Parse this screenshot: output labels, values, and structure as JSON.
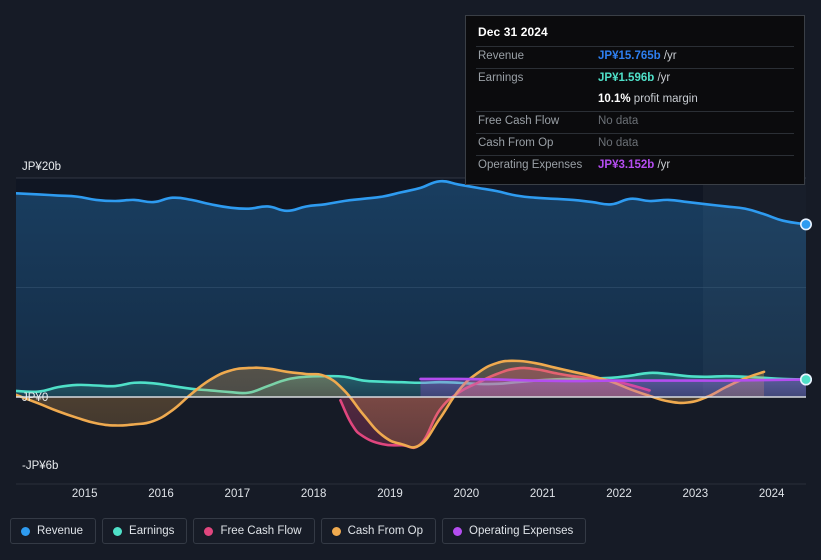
{
  "tooltip": {
    "title": "Dec 31 2024",
    "rows": [
      {
        "label": "Revenue",
        "value": "JP¥15.765b",
        "unit": "/yr",
        "style": "v-rev"
      },
      {
        "label": "Earnings",
        "value": "JP¥1.596b",
        "unit": "/yr",
        "style": "v-earn"
      },
      {
        "label": "",
        "value": "10.1%",
        "unit": "profit margin",
        "style": "v-margin"
      },
      {
        "label": "Free Cash Flow",
        "value": "No data",
        "unit": "",
        "style": "v-none"
      },
      {
        "label": "Cash From Op",
        "value": "No data",
        "unit": "",
        "style": "v-none"
      },
      {
        "label": "Operating Expenses",
        "value": "JP¥3.152b",
        "unit": "/yr",
        "style": "v-opex"
      }
    ]
  },
  "legend": {
    "items": [
      {
        "label": "Revenue",
        "color": "#2e9bf0"
      },
      {
        "label": "Earnings",
        "color": "#4fe0c8"
      },
      {
        "label": "Free Cash Flow",
        "color": "#e0467e"
      },
      {
        "label": "Cash From Op",
        "color": "#efaa4f"
      },
      {
        "label": "Operating Expenses",
        "color": "#b44df0"
      }
    ]
  },
  "axes": {
    "y_top_label": "JP¥20b",
    "y_zero_label": "JP¥0",
    "y_bottom_label": "-JP¥6b"
  },
  "chart_data": {
    "type": "area",
    "title": "",
    "xlabel": "",
    "ylabel": "",
    "currency": "JP¥",
    "unit": "b",
    "ylim": [
      -6,
      20
    ],
    "yticks": [
      20,
      0,
      -6
    ],
    "ytick_labels": [
      "JP¥20b",
      "JP¥0",
      "-JP¥6b"
    ],
    "grid": true,
    "legend_position": "bottom-left",
    "categories": [
      2015,
      2016,
      2017,
      2018,
      2019,
      2020,
      2021,
      2022,
      2023,
      2024
    ],
    "xtick_labels": [
      "2015",
      "2016",
      "2017",
      "2018",
      "2019",
      "2020",
      "2021",
      "2022",
      "2023",
      "2024"
    ],
    "x_domain": [
      2014.6,
      2024.95
    ],
    "forecast_band_start": 2023.6,
    "series": [
      {
        "name": "Revenue",
        "color": "#2e9bf0",
        "fill": "#1d4a6e",
        "x": [
          2014.6,
          2014.9,
          2015.15,
          2015.4,
          2015.65,
          2015.9,
          2016.15,
          2016.4,
          2016.65,
          2016.9,
          2017.15,
          2017.4,
          2017.65,
          2017.9,
          2018.15,
          2018.4,
          2018.65,
          2018.9,
          2019.15,
          2019.4,
          2019.65,
          2019.9,
          2020.15,
          2020.4,
          2020.65,
          2020.9,
          2021.15,
          2021.4,
          2021.65,
          2021.9,
          2022.15,
          2022.4,
          2022.65,
          2022.9,
          2023.15,
          2023.4,
          2023.65,
          2023.9,
          2024.15,
          2024.4,
          2024.65,
          2024.95
        ],
        "values": [
          18.6,
          18.5,
          18.4,
          18.3,
          18.0,
          17.9,
          18.0,
          17.8,
          18.2,
          18.0,
          17.6,
          17.3,
          17.2,
          17.4,
          17.0,
          17.4,
          17.6,
          17.9,
          18.1,
          18.3,
          18.7,
          19.1,
          19.7,
          19.4,
          19.1,
          18.8,
          18.4,
          18.2,
          18.1,
          18.0,
          17.8,
          17.6,
          18.1,
          17.9,
          18.0,
          17.8,
          17.6,
          17.4,
          17.2,
          16.7,
          16.1,
          15.765
        ]
      },
      {
        "name": "Earnings",
        "color": "#4fe0c8",
        "fill": "#1f5f5e",
        "x": [
          2014.6,
          2014.9,
          2015.15,
          2015.4,
          2015.65,
          2015.9,
          2016.15,
          2016.4,
          2016.65,
          2016.9,
          2017.15,
          2017.4,
          2017.65,
          2017.9,
          2018.15,
          2018.4,
          2018.65,
          2018.9,
          2019.15,
          2019.4,
          2019.65,
          2019.9,
          2020.15,
          2020.4,
          2020.65,
          2020.9,
          2021.15,
          2021.4,
          2021.65,
          2021.9,
          2022.15,
          2022.4,
          2022.65,
          2022.9,
          2023.15,
          2023.4,
          2023.65,
          2023.9,
          2024.15,
          2024.4,
          2024.65,
          2024.95
        ],
        "values": [
          0.55,
          0.5,
          0.9,
          1.1,
          1.05,
          1.0,
          1.3,
          1.25,
          1.0,
          0.75,
          0.6,
          0.45,
          0.4,
          1.0,
          1.6,
          1.85,
          1.9,
          1.85,
          1.5,
          1.4,
          1.35,
          1.3,
          1.35,
          1.3,
          1.2,
          1.2,
          1.35,
          1.5,
          1.6,
          1.65,
          1.7,
          1.75,
          1.95,
          2.2,
          2.1,
          1.9,
          1.85,
          1.9,
          1.85,
          1.75,
          1.65,
          1.596
        ]
      },
      {
        "name": "Free Cash Flow",
        "color": "#e0467e",
        "fill": "#6e2436",
        "x": [
          2018.85,
          2019.0,
          2019.15,
          2019.4,
          2019.65,
          2019.9,
          2020.15,
          2020.4,
          2020.65,
          2020.9,
          2021.15,
          2021.4,
          2021.65,
          2021.9,
          2022.15,
          2022.4,
          2022.65,
          2022.9
        ],
        "values": [
          -0.3,
          -2.5,
          -3.6,
          -4.3,
          -4.4,
          -4.3,
          -1.2,
          0.4,
          1.3,
          2.1,
          2.6,
          2.55,
          2.2,
          1.9,
          1.7,
          1.5,
          1.1,
          0.6
        ]
      },
      {
        "name": "Cash From Op",
        "color": "#efaa4f",
        "fill": "#6b5a33",
        "x": [
          2014.6,
          2014.9,
          2015.15,
          2015.4,
          2015.65,
          2015.9,
          2016.15,
          2016.4,
          2016.65,
          2016.9,
          2017.15,
          2017.4,
          2017.65,
          2017.9,
          2018.15,
          2018.4,
          2018.65,
          2018.9,
          2019.15,
          2019.4,
          2019.65,
          2019.9,
          2020.15,
          2020.4,
          2020.65,
          2020.9,
          2021.15,
          2021.4,
          2021.65,
          2021.9,
          2022.15,
          2022.4,
          2022.65,
          2022.9,
          2023.15,
          2023.4,
          2023.65,
          2023.9,
          2024.15,
          2024.4
        ],
        "values": [
          0.2,
          -0.6,
          -1.3,
          -1.9,
          -2.4,
          -2.6,
          -2.5,
          -2.2,
          -1.2,
          0.3,
          1.6,
          2.4,
          2.65,
          2.6,
          2.3,
          2.1,
          1.9,
          0.6,
          -1.6,
          -3.5,
          -4.3,
          -4.35,
          -2.0,
          0.6,
          2.2,
          3.1,
          3.3,
          3.1,
          2.7,
          2.3,
          1.9,
          1.4,
          0.7,
          0.1,
          -0.4,
          -0.5,
          0.0,
          0.9,
          1.7,
          2.3
        ]
      },
      {
        "name": "Operating Expenses",
        "color": "#b44df0",
        "fill": "#4b2a6e",
        "x": [
          2019.9,
          2020.4,
          2020.9,
          2021.4,
          2021.9,
          2022.4,
          2022.9,
          2023.4,
          2023.9,
          2024.4,
          2024.95
        ],
        "values": [
          1.65,
          1.65,
          1.6,
          1.5,
          1.45,
          1.5,
          1.5,
          1.5,
          1.5,
          1.55,
          1.6
        ]
      }
    ],
    "endpoints": [
      {
        "series": "Revenue",
        "x": 2024.95,
        "y": 15.765,
        "color": "#2e9bf0"
      },
      {
        "series": "Operating Expenses",
        "x": 2024.95,
        "y": 1.6,
        "color": "#b44df0"
      },
      {
        "series": "Earnings",
        "x": 2024.95,
        "y": 1.596,
        "color": "#4fe0c8"
      }
    ]
  }
}
